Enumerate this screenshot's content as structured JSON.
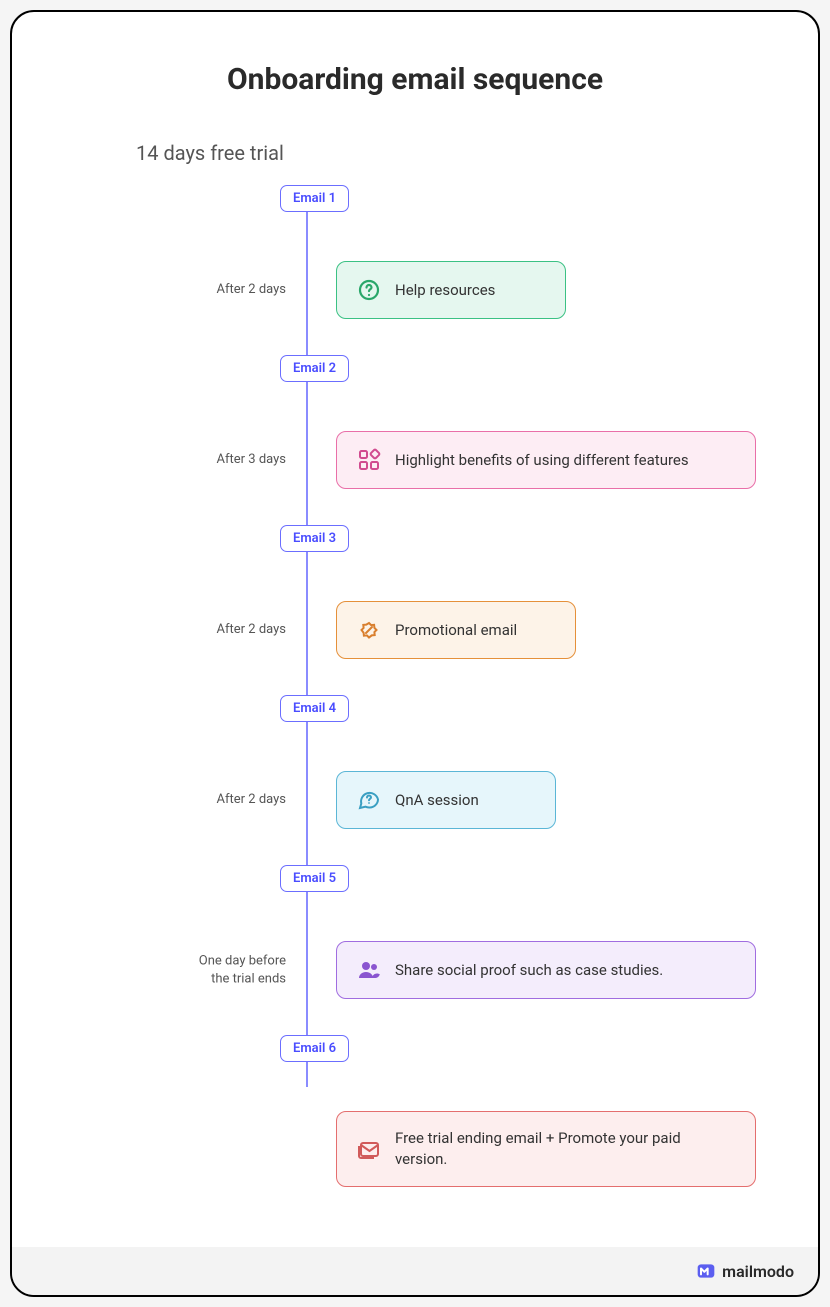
{
  "title": "Onboarding email sequence",
  "subtitle": "14 days free trial",
  "steps": [
    {
      "badge": "Email 1",
      "left": "",
      "card": null
    },
    {
      "badge": "",
      "left": "After 2 days",
      "card": {
        "style": "green",
        "icon": "help-icon",
        "text": "Help resources"
      }
    },
    {
      "badge": "Email 2",
      "left": "",
      "card": null
    },
    {
      "badge": "",
      "left": "After 3 days",
      "card": {
        "style": "pink",
        "icon": "widgets-icon",
        "text": "Highlight benefits of using different features"
      }
    },
    {
      "badge": "Email 3",
      "left": "",
      "card": null
    },
    {
      "badge": "",
      "left": "After 2 days",
      "card": {
        "style": "orange",
        "icon": "promo-icon",
        "text": "Promotional email"
      }
    },
    {
      "badge": "Email 4",
      "left": "",
      "card": null
    },
    {
      "badge": "",
      "left": "After 2 days",
      "card": {
        "style": "cyan",
        "icon": "chat-icon",
        "text": "QnA session"
      }
    },
    {
      "badge": "Email 5",
      "left": "",
      "card": null
    },
    {
      "badge": "",
      "left": "One day before\nthe trial ends",
      "card": {
        "style": "purple",
        "icon": "people-icon",
        "text": "Share social proof such as case studies."
      }
    },
    {
      "badge": "Email 6",
      "left": "",
      "card": null
    },
    {
      "badge": "",
      "left": "",
      "card": {
        "style": "red",
        "icon": "mail-icon",
        "text": "Free trial ending email + Promote your paid version."
      }
    }
  ],
  "brand": "mailmodo"
}
